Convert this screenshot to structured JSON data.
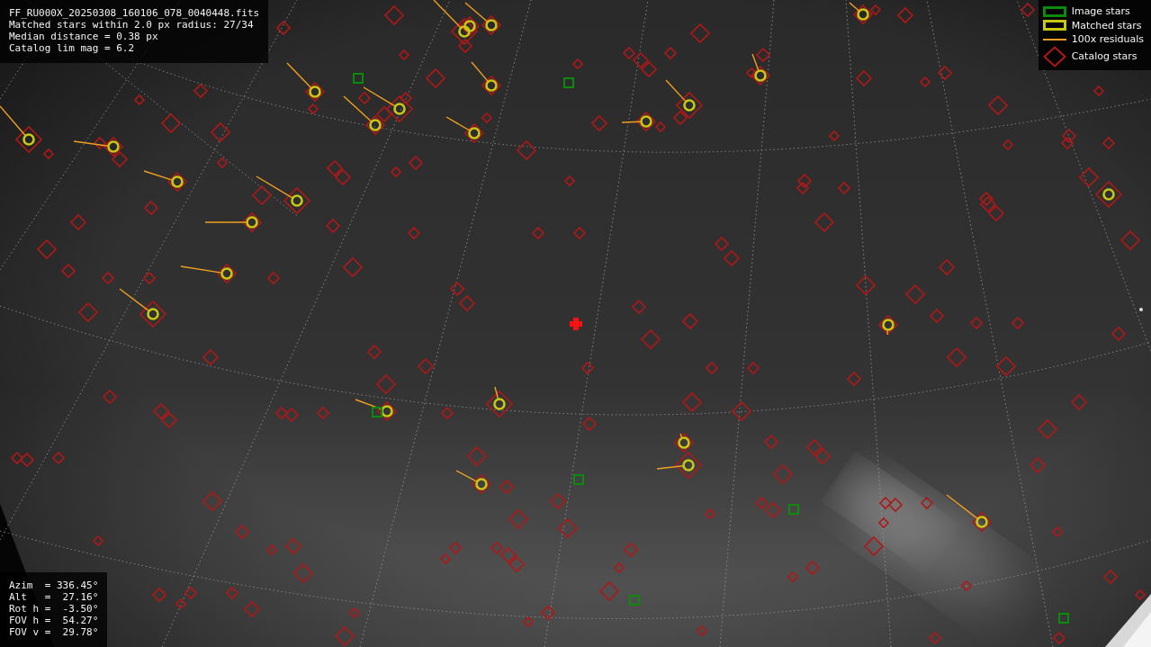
{
  "info_panel": {
    "lines": [
      "FF_RU000X_20250308_160106_078_0040448.fits",
      "Matched stars within 2.0 px radius: 27/34",
      "Median distance = 0.38 px",
      "Catalog lim mag = 6.2"
    ]
  },
  "legend": {
    "items": [
      {
        "label": "Image stars",
        "color": "#0c8a0c"
      },
      {
        "kind": "matched",
        "label": "Matched stars",
        "color": "#c8c814"
      },
      {
        "kind": "residual",
        "label": "100x residuals",
        "color": "#f0a020"
      },
      {
        "kind": "catalog",
        "label": "Catalog stars",
        "color": "#b01818"
      }
    ]
  },
  "pointing_panel": {
    "lines": [
      "Azim  = 336.45°",
      "Alt   =  27.16°",
      "Rot h =  -3.50°",
      "FOV h =  54.27°",
      "FOV v =  29.78°"
    ]
  }
}
